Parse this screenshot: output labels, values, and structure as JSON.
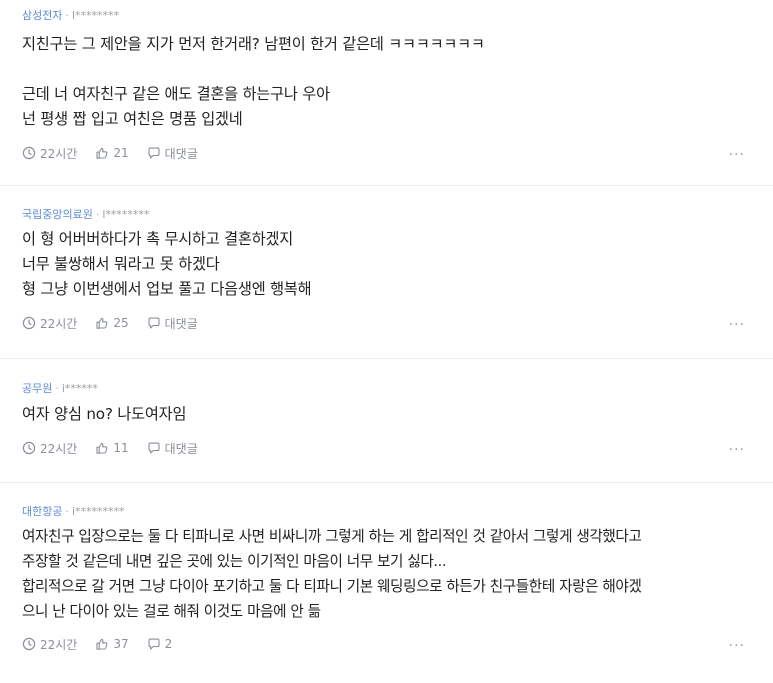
{
  "comments": [
    {
      "company": "삼성전자",
      "user": "l********",
      "text": "지친구는 그 제안을 지가 먼저 한거래? 남편이 한거 같은데 ㅋㅋㅋㅋㅋㅋㅋ\n\n근데 너 여자친구 같은 애도 결혼을 하는구나 우아\n넌 평생 짭 입고 여친은 명품 입겠네",
      "time": "22시간",
      "likes": "21",
      "reply": "대댓글"
    },
    {
      "company": "국립중앙의료원",
      "user": "l********",
      "text": "이 형 어버버하다가 촉 무시하고 결혼하겠지\n너무 불쌍해서 뭐라고 못 하겠다\n형 그냥 이번생에서 업보 풀고 다음생엔 행복해",
      "time": "22시간",
      "likes": "25",
      "reply": "대댓글"
    },
    {
      "company": "공무원",
      "user": "i******",
      "text": "여자 양심 no? 나도여자임",
      "time": "22시간",
      "likes": "11",
      "reply": "대댓글"
    },
    {
      "company": "대한항공",
      "user": "i*********",
      "text": "여자친구 입장으로는 둘 다 티파니로 사면 비싸니까 그렇게 하는 게 합리적인 것 같아서 그렇게 생각했다고\n주장할 것 같은데 내면 깊은 곳에 있는 이기적인 마음이 너무 보기 싫다...\n합리적으로 갈 거면 그냥 다이아 포기하고 둘 다 티파니 기본 웨딩링으로 하든가 친구들한테 자랑은 해야겠\n으니 난 다이아 있는 걸로 해줘 이것도 마음에 안 듦",
      "time": "22시간",
      "likes": "37",
      "reply": "2"
    }
  ],
  "more_label": "···"
}
